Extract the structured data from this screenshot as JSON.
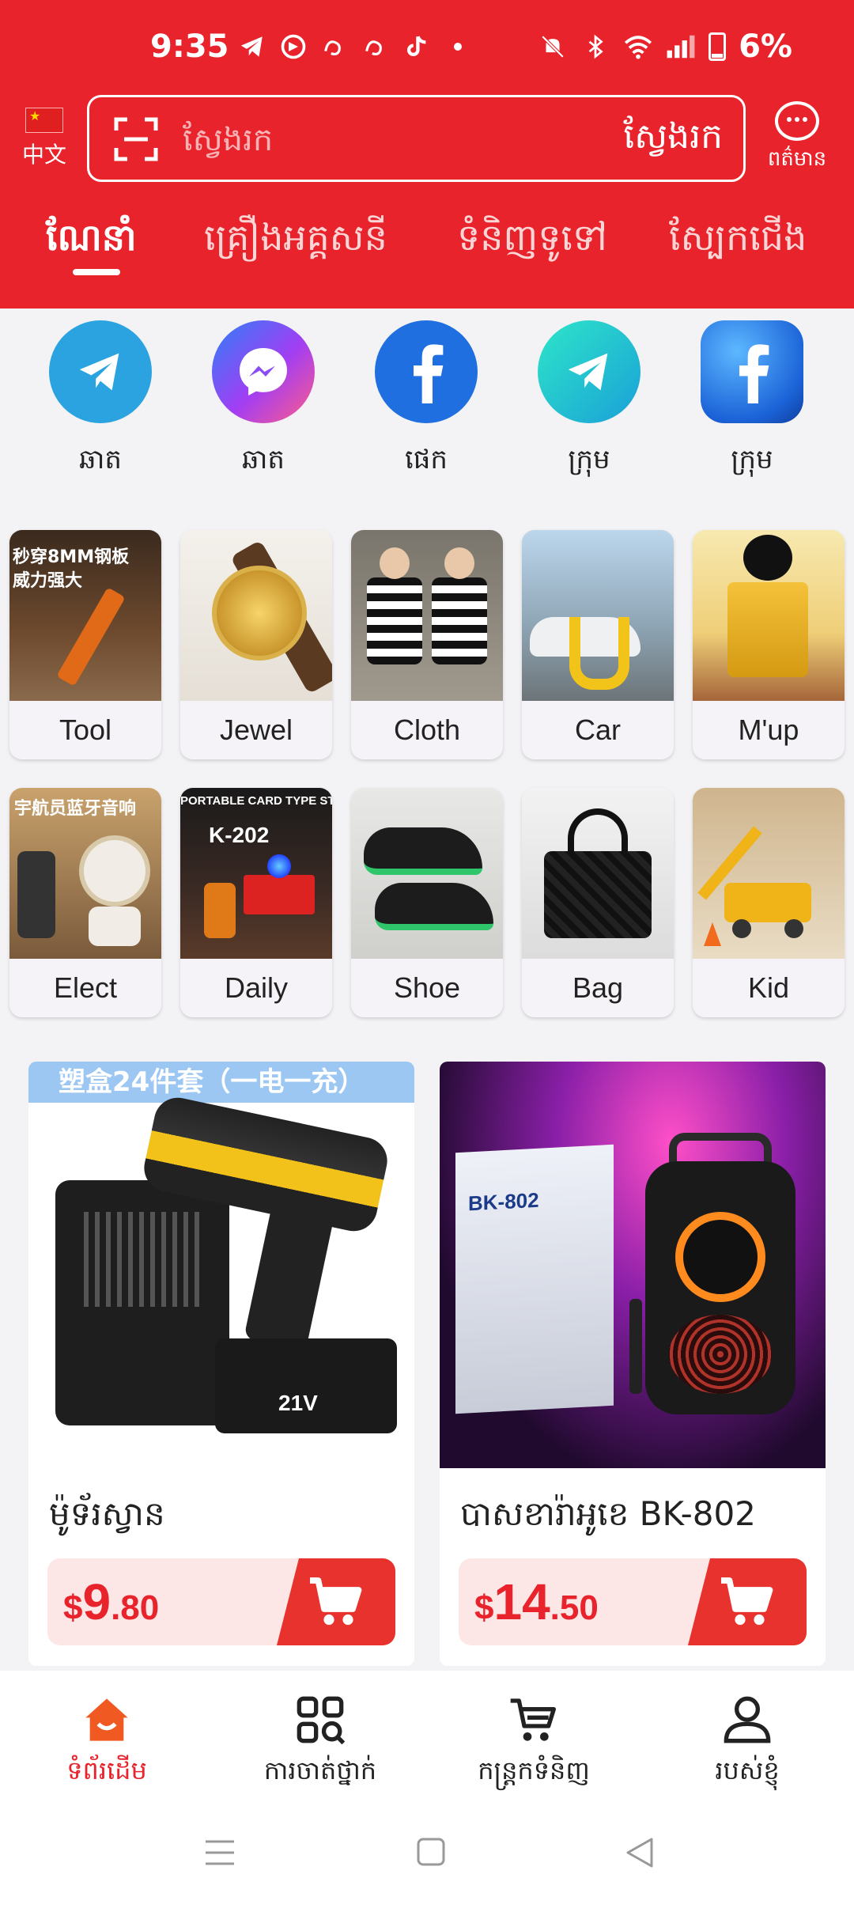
{
  "status": {
    "time": "9:35",
    "battery": "6%",
    "left_icons": [
      "telegram-icon",
      "maps-icon",
      "threads-icon",
      "threads-icon",
      "tiktok-icon",
      "dot-icon"
    ],
    "right_icons": [
      "mute-icon",
      "bluetooth-icon",
      "wifi-icon",
      "signal-icon",
      "battery-icon"
    ]
  },
  "header": {
    "language_label": "中文",
    "search_placeholder": "ស្វែងរក",
    "search_button": "ស្វែងរក",
    "message_label": "ពត៌មាន",
    "tabs": [
      {
        "label": "ណែនាំ",
        "active": true
      },
      {
        "label": "គ្រឿងអគ្គសនី",
        "active": false
      },
      {
        "label": "ទំនិញទូទៅ",
        "active": false
      },
      {
        "label": "ស្បែកជើង",
        "active": false
      }
    ]
  },
  "social": [
    {
      "label": "ឆាត",
      "icon": "telegram-icon"
    },
    {
      "label": "ឆាត",
      "icon": "messenger-icon"
    },
    {
      "label": "ផេក",
      "icon": "facebook-icon"
    },
    {
      "label": "ក្រុម",
      "icon": "telegram-icon"
    },
    {
      "label": "ក្រុម",
      "icon": "facebook-icon"
    }
  ],
  "categories": [
    {
      "label": "Tool",
      "image_text": "秒穿8MM钢板 威力强大"
    },
    {
      "label": "Jewel"
    },
    {
      "label": "Cloth"
    },
    {
      "label": "Car"
    },
    {
      "label": "M'up"
    },
    {
      "label": "Elect",
      "image_text": "宇航员蓝牙音响"
    },
    {
      "label": "Daily",
      "image_text": "PORTABLE CARD TYPE STOVE",
      "image_subtext": "K-202"
    },
    {
      "label": "Shoe"
    },
    {
      "label": "Bag"
    },
    {
      "label": "Kid"
    }
  ],
  "products": [
    {
      "name": "ម៉ូទ័រស្វាន",
      "banner": "塑盒24件套（一电一充）",
      "currency": "$",
      "price_int": "9",
      "price_dec": ".80",
      "badge": "21V"
    },
    {
      "name": "បាសខារ៉ាអូខេ BK-802",
      "model": "BK-802",
      "currency": "$",
      "price_int": "14",
      "price_dec": ".50"
    }
  ],
  "bottom_nav": [
    {
      "label": "ទំព័រដើម",
      "icon": "home-icon",
      "active": true
    },
    {
      "label": "ការចាត់ថ្នាក់",
      "icon": "category-icon",
      "active": false
    },
    {
      "label": "កន្ត្រកទំនិញ",
      "icon": "cart-icon",
      "active": false
    },
    {
      "label": "របស់ខ្ញុំ",
      "icon": "profile-icon",
      "active": false
    }
  ],
  "colors": {
    "brand_red": "#e8232b",
    "background": "#f3f2f4",
    "price_bg": "#fde7e6"
  }
}
